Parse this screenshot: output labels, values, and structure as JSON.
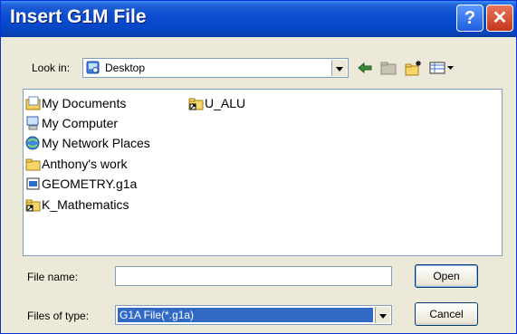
{
  "window": {
    "title": "Insert G1M File"
  },
  "titlebar": {
    "help_label": "?",
    "close_label": "✕"
  },
  "lookin": {
    "label": "Look in:",
    "value": "Desktop"
  },
  "toolbar": {
    "back_icon": "back-arrow-icon",
    "up_icon": "up-folder-icon",
    "new_folder_icon": "new-folder-icon",
    "views_icon": "views-menu-icon"
  },
  "files": [
    {
      "name": "My Documents",
      "icon": "my-documents-icon"
    },
    {
      "name": "My Computer",
      "icon": "my-computer-icon"
    },
    {
      "name": "My Network Places",
      "icon": "network-places-icon"
    },
    {
      "name": "Anthony's work",
      "icon": "folder-icon"
    },
    {
      "name": "GEOMETRY.g1a",
      "icon": "g1a-file-icon"
    },
    {
      "name": "K_Mathematics",
      "icon": "shortcut-folder-icon"
    },
    {
      "name": "U_ALU",
      "icon": "shortcut-folder-icon"
    }
  ],
  "filename": {
    "label": "File name:",
    "value": ""
  },
  "filetype": {
    "label": "Files of type:",
    "value": "G1A File(*.g1a)"
  },
  "buttons": {
    "open": "Open",
    "cancel": "Cancel"
  }
}
